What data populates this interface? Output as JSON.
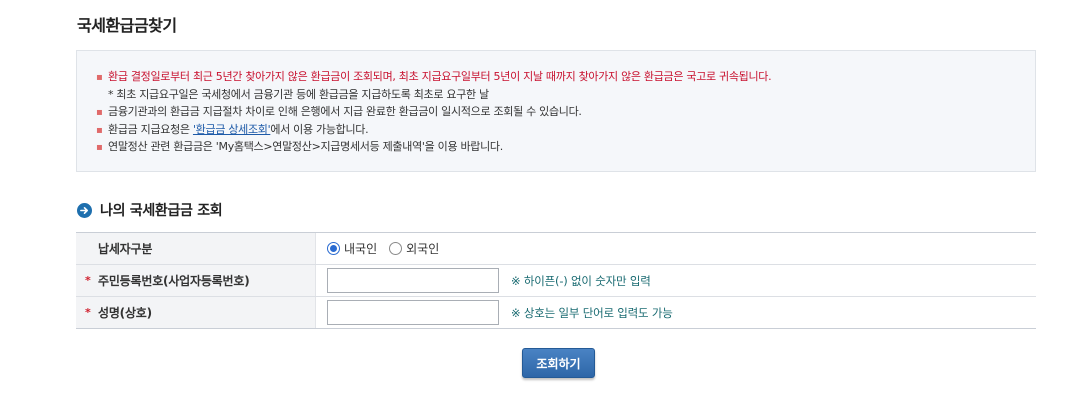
{
  "page": {
    "title": "국세환급금찾기"
  },
  "notice": {
    "line1": "환급 결정일로부터 최근 5년간 찾아가지 않은 환급금이 조회되며, 최초 지급요구일부터 5년이 지날 때까지 찾아가지 않은 환급금은 국고로 귀속됩니다.",
    "line1_sub": "* 최초 지급요구일은 국세청에서 금융기관 등에 환급금을 지급하도록 최초로 요구한 날",
    "line2": "금융기관과의 환급금 지급절차 차이로 인해 은행에서 지급 완료한 환급금이 일시적으로 조회될 수 있습니다.",
    "line3_prefix": "환급금 지급요청은 ",
    "line3_link": "'환급금 상세조회'",
    "line3_suffix": "에서 이용 가능합니다.",
    "line4": "연말정산 관련 환급금은 'My홈택스>연말정산>지급명세서등 제출내역'을 이용 바랍니다."
  },
  "section": {
    "title": "나의 국세환급금 조회"
  },
  "form": {
    "taxpayer_type": {
      "label": "납세자구분",
      "options": [
        "내국인",
        "외국인"
      ],
      "selected": "내국인"
    },
    "id_number": {
      "label": "주민등록번호(사업자등록번호)",
      "value": "",
      "hint": "※ 하이픈(-) 없이 숫자만 입력"
    },
    "name": {
      "label": "성명(상호)",
      "value": "",
      "hint": "※ 상호는 일부 단어로 입력도 가능"
    }
  },
  "actions": {
    "search_label": "조회하기"
  },
  "colors": {
    "accent": "#2d66a8",
    "required": "#d0202e",
    "warning_text": "#c8102e",
    "hint_text": "#1a6b72"
  }
}
